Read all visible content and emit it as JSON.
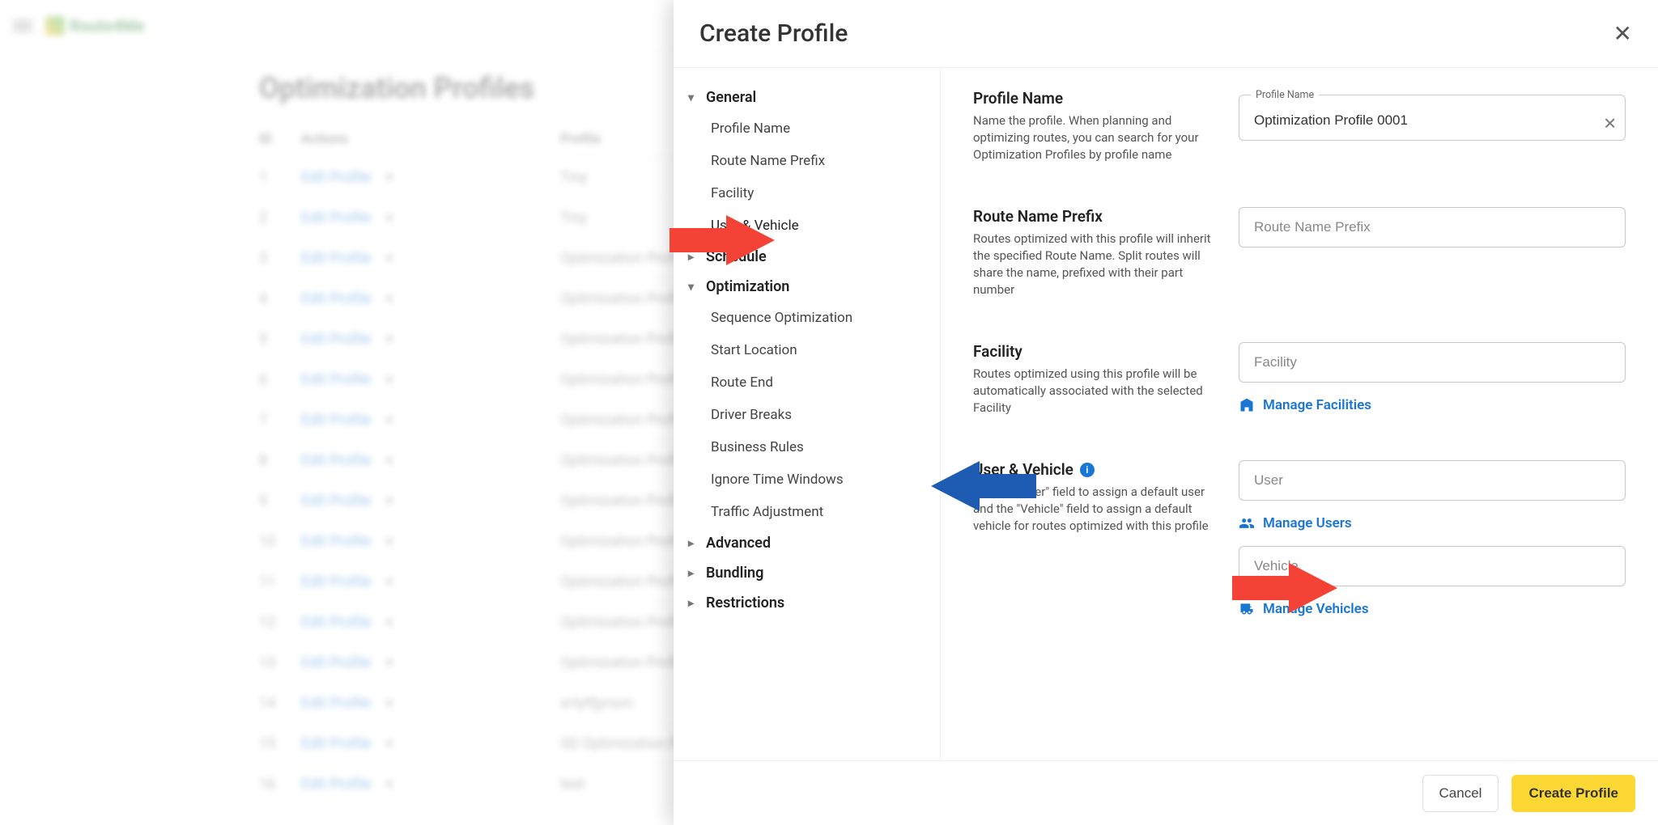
{
  "app": {
    "brand": "Route4Me"
  },
  "background": {
    "title": "Optimization Profiles",
    "columns": {
      "id": "ID",
      "actions": "Actions",
      "profile": "Profile"
    },
    "edit_label": "Edit Profile",
    "arrow_glyph": "▾",
    "rows": [
      {
        "id": "1",
        "profile": "Tiny"
      },
      {
        "id": "2",
        "profile": "Tiny"
      },
      {
        "id": "3",
        "profile": "Optimization Profile…"
      },
      {
        "id": "4",
        "profile": "Optimization Profile…"
      },
      {
        "id": "5",
        "profile": "Optimization Profile…"
      },
      {
        "id": "6",
        "profile": "Optimization Profile…"
      },
      {
        "id": "7",
        "profile": "Optimization Profile…"
      },
      {
        "id": "8",
        "profile": "Optimization Profile…"
      },
      {
        "id": "9",
        "profile": "Optimization Profile…"
      },
      {
        "id": "10",
        "profile": "Optimization Profile…"
      },
      {
        "id": "11",
        "profile": "Optimization Profile…"
      },
      {
        "id": "12",
        "profile": "Optimization Profile…"
      },
      {
        "id": "13",
        "profile": "Optimization Profile…"
      },
      {
        "id": "14",
        "profile": "xrtytfjynsm"
      },
      {
        "id": "15",
        "profile": "SD Optimization Profile"
      },
      {
        "id": "16",
        "profile": "test"
      }
    ]
  },
  "drawer": {
    "title": "Create Profile",
    "nav": {
      "general": "General",
      "profile_name": "Profile Name",
      "route_prefix": "Route Name Prefix",
      "facility": "Facility",
      "user_vehicle": "User & Vehicle",
      "schedule": "Schedule",
      "optimization": "Optimization",
      "seq_opt": "Sequence Optimization",
      "start_loc": "Start Location",
      "route_end": "Route End",
      "driver_breaks": "Driver Breaks",
      "business_rules": "Business Rules",
      "ignore_tw": "Ignore Time Windows",
      "traffic_adj": "Traffic Adjustment",
      "advanced": "Advanced",
      "bundling": "Bundling",
      "restrictions": "Restrictions"
    },
    "fields": {
      "profile_name": {
        "title": "Profile Name",
        "desc": "Name the profile. When planning and optimizing routes, you can search for your Optimization Profiles by profile name",
        "legend": "Profile Name",
        "value": "Optimization Profile 0001"
      },
      "route_prefix": {
        "title": "Route Name Prefix",
        "desc": "Routes optimized with this profile will inherit the specified Route Name. Split routes will share the name, prefixed with their part number",
        "placeholder": "Route Name Prefix"
      },
      "facility": {
        "title": "Facility",
        "desc": "Routes optimized using this profile will be automatically associated with the selected Facility",
        "placeholder": "Facility",
        "manage": "Manage Facilities"
      },
      "user_vehicle": {
        "title": "User & Vehicle",
        "desc": "Use the \"User\" field to assign a default user and the \"Vehicle\" field to assign a default vehicle for routes optimized with this profile",
        "user_placeholder": "User",
        "vehicle_placeholder": "Vehicle",
        "manage_users": "Manage Users",
        "manage_vehicles": "Manage Vehicles"
      }
    },
    "footer": {
      "cancel": "Cancel",
      "create": "Create Profile"
    }
  }
}
